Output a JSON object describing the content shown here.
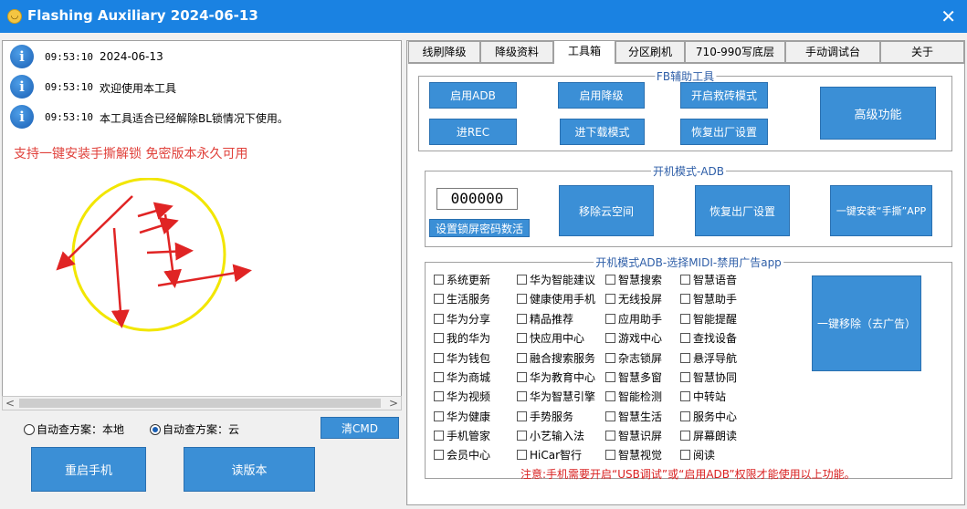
{
  "window": {
    "title": "Flashing Auxiliary 2024-06-13",
    "close_glyph": "✕",
    "app_icon": "smiley-icon"
  },
  "log": [
    {
      "time": "09:53:10",
      "message": "2024-06-13"
    },
    {
      "time": "09:53:10",
      "message": "欢迎使用本工具"
    },
    {
      "time": "09:53:10",
      "message": "本工具适合已经解除BL锁情况下使用。"
    }
  ],
  "log_icon_glyph": "i",
  "promo_text": "支持一键安装手撕解锁 免密版本永久可用",
  "colors": {
    "accent": "#3b8fd6",
    "title_bar": "#1a82e2",
    "promo": "#e0413b",
    "note": "#d92020",
    "gesture_circle": "#f2e600",
    "gesture_arrow": "#e02424"
  },
  "scroll": {
    "left_arrow": "<",
    "right_arrow": ">"
  },
  "query": {
    "local_label": "自动查方案：本地",
    "cloud_label": "自动查方案：云",
    "selected": "cloud"
  },
  "left_buttons": {
    "clear_cmd": "清CMD",
    "reboot": "重启手机",
    "read_version": "读版本"
  },
  "tabs": [
    {
      "label": "线刷降级",
      "active": false
    },
    {
      "label": "降级资料",
      "active": false
    },
    {
      "label": "工具箱",
      "active": true
    },
    {
      "label": "分区刷机",
      "active": false
    },
    {
      "label": "710-990写底层",
      "active": false
    },
    {
      "label": "手动调试台",
      "active": false
    },
    {
      "label": "关于",
      "active": false
    }
  ],
  "fb_tools": {
    "title": "FB辅助工具",
    "buttons": [
      "启用ADB",
      "启用降级",
      "开启救砖模式",
      "进REC",
      "进下载模式",
      "恢复出厂设置"
    ],
    "advanced": "高级功能"
  },
  "adb_mode": {
    "title": "开机模式-ADB",
    "pin_value": "000000",
    "set_lock_pwd": "设置锁屏密码数活",
    "remove_cloud": "移除云空间",
    "factory_reset": "恢复出厂设置",
    "install_app": "一键安装“手撕”APP"
  },
  "disable_ads": {
    "title": "开机模式ADB-选择MIDI-禁用广告app",
    "columns": [
      [
        "系统更新",
        "生活服务",
        "华为分享",
        "我的华为",
        "华为钱包",
        "华为商城",
        "华为视频",
        "华为健康",
        "手机管家",
        "会员中心"
      ],
      [
        "华为智能建议",
        "健康使用手机",
        "精品推荐",
        "快应用中心",
        "融合搜索服务",
        "华为教育中心",
        "华为智慧引擎",
        "手势服务",
        "小艺输入法",
        "HiCar智行"
      ],
      [
        "智慧搜索",
        "无线投屏",
        "应用助手",
        "游戏中心",
        "杂志锁屏",
        "智慧多窗",
        "智能检测",
        "智慧生活",
        "智慧识屏",
        "智慧视觉"
      ],
      [
        "智慧语音",
        "智慧助手",
        "智能提醒",
        "查找设备",
        "悬浮导航",
        "智慧协同",
        "中转站",
        "服务中心",
        "屏幕朗读",
        "阅读"
      ]
    ],
    "remove_button": "一键移除（去广告）",
    "note": "注意:手机需要开启“USB调试”或“启用ADB”权限才能使用以上功能。"
  }
}
